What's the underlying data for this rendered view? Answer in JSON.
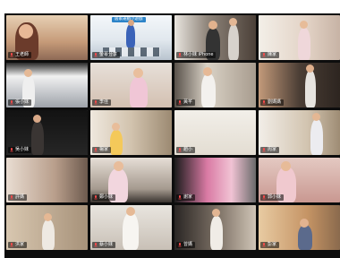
{
  "meeting": {
    "participants": [
      {
        "name": "王老師",
        "tile": "teacher-webcam",
        "color": "#c9a27a"
      },
      {
        "name": "螢幕分享",
        "tile": "screen-share",
        "color": "#dfe9ef",
        "share_title": "居家運動小遊戲"
      },
      {
        "name": "林小妹 iPhone",
        "tile": "living-room",
        "color": "#8a7d72"
      },
      {
        "name": "陳家",
        "tile": "bright-room",
        "color": "#e6d8cf"
      },
      {
        "name": "張小妹",
        "tile": "kitchen",
        "color": "#9a9b9f"
      },
      {
        "name": "李佳",
        "tile": "pink-shirt",
        "color": "#d8c6b8"
      },
      {
        "name": "黃芊",
        "tile": "doorway",
        "color": "#a79d90"
      },
      {
        "name": "劉媽媽",
        "tile": "dancing",
        "color": "#5a4e46"
      },
      {
        "name": "吳小妹",
        "tile": "dark-room",
        "color": "#2b2b2b"
      },
      {
        "name": "楊家",
        "tile": "shelf",
        "color": "#d6c9b7"
      },
      {
        "name": "趙小",
        "tile": "white-room",
        "color": "#e9e4db"
      },
      {
        "name": "周家",
        "tile": "window",
        "color": "#cfc2ae"
      },
      {
        "name": "許媽",
        "tile": "window-left",
        "color": "#c7b4a4"
      },
      {
        "name": "鄭小妹",
        "tile": "sofa",
        "color": "#bfb2a6"
      },
      {
        "name": "謝家",
        "tile": "toys",
        "color": "#b96e8c"
      },
      {
        "name": "郭小妹",
        "tile": "bed",
        "color": "#cfa9a2"
      },
      {
        "name": "洪家",
        "tile": "hall",
        "color": "#cdbca5"
      },
      {
        "name": "蔡小妹",
        "tile": "standing",
        "color": "#d9d3cb"
      },
      {
        "name": "曾媽",
        "tile": "dark-bedroom",
        "color": "#55504a"
      },
      {
        "name": "彭家",
        "tile": "curtain",
        "color": "#d8b187"
      }
    ]
  }
}
